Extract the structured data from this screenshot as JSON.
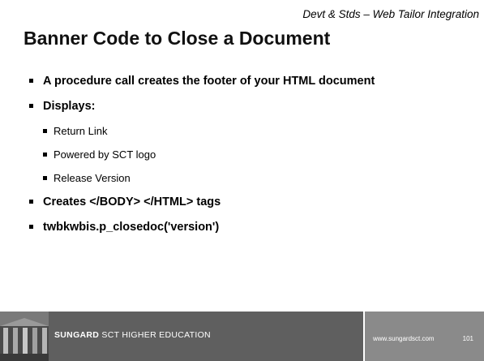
{
  "header": {
    "note": "Devt & Stds – Web Tailor Integration"
  },
  "slide": {
    "title": "Banner Code to Close a Document",
    "bullets": {
      "b1": "A procedure call creates the footer of your HTML document",
      "b2": "Displays:",
      "b2_subs": [
        "Return Link",
        "Powered by SCT logo",
        "Release Version"
      ],
      "b3": "Creates </BODY> </HTML> tags",
      "b4": "twbkwbis.p_closedoc('version')"
    }
  },
  "footer": {
    "brand_bold": "SUNGARD",
    "brand_rest": " SCT HIGHER EDUCATION",
    "url": "www.sungardsct.com",
    "page_number": "101",
    "photo_icon": "building-photo-icon",
    "colors": {
      "bar_dark": "#5f5f5f",
      "bar_light": "#8a8a8a"
    }
  }
}
